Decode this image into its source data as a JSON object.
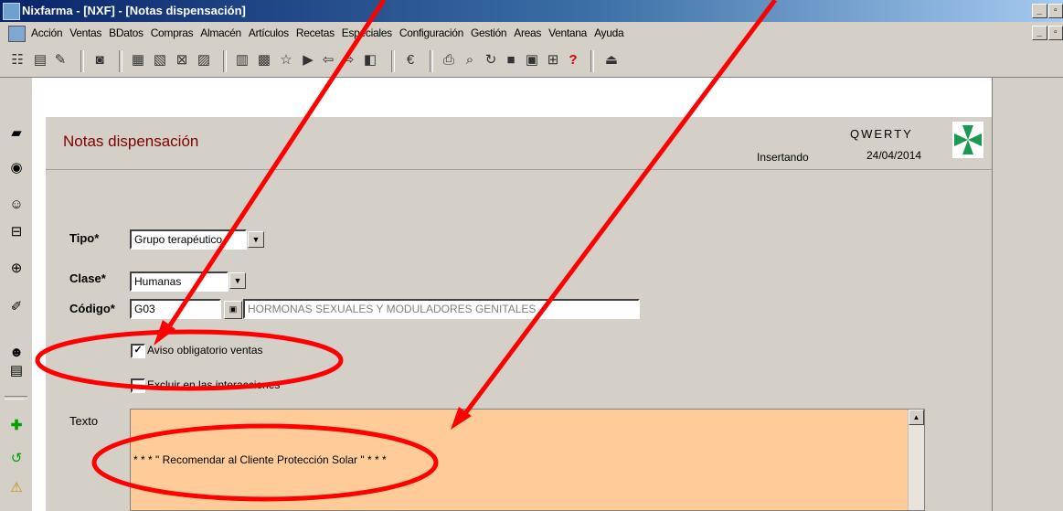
{
  "window": {
    "title": "Nixfarma - [NXF] - [Notas dispensación]",
    "min": "_",
    "restore": "▫",
    "close": "×"
  },
  "menu": {
    "items": [
      "Acción",
      "Ventas",
      "BDatos",
      "Compras",
      "Almacén",
      "Artículos",
      "Recetas",
      "Especiales",
      "Configuración",
      "Gestión",
      "Areas",
      "Ventana",
      "Ayuda"
    ]
  },
  "header": {
    "title": "Notas dispensación",
    "status": "Insertando",
    "company": "QWERTY",
    "date": "24/04/2014"
  },
  "form": {
    "tipo": {
      "label": "Tipo*",
      "value": "Grupo terapéutico"
    },
    "clase": {
      "label": "Clase*",
      "value": "Humanas"
    },
    "codigo": {
      "label": "Código*",
      "value": "G03",
      "description": "HORMONAS SEXUALES Y MODULADORES GENITALES"
    },
    "aviso": {
      "label": "Aviso obligatorio ventas",
      "checked": true
    },
    "excluir": {
      "label": "Excluir en las interacciones",
      "checked": false
    },
    "texto": {
      "label": "Texto",
      "value": "* * * \" Recomendar al Cliente Protección Solar \" * * *"
    }
  },
  "colors": {
    "accent_title": "#800000",
    "text_area_bg": "#ffcc99",
    "annotation_red": "#ff0000",
    "logo_green": "#1a9a50"
  }
}
